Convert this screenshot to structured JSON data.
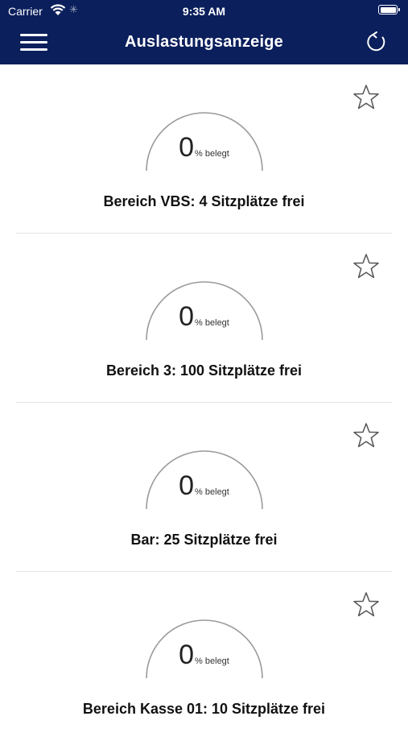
{
  "status_bar": {
    "carrier": "Carrier",
    "time": "9:35 AM"
  },
  "nav": {
    "title": "Auslastungsanzeige"
  },
  "areas": [
    {
      "occupancy_percent": "0",
      "unit": "% belegt",
      "title": "Bereich VBS: 4 Sitzplätze frei"
    },
    {
      "occupancy_percent": "0",
      "unit": "% belegt",
      "title": "Bereich 3: 100 Sitzplätze frei"
    },
    {
      "occupancy_percent": "0",
      "unit": "% belegt",
      "title": "Bar: 25 Sitzplätze frei"
    },
    {
      "occupancy_percent": "0",
      "unit": "% belegt",
      "title": "Bereich Kasse 01: 10 Sitzplätze frei"
    }
  ],
  "colors": {
    "header": "#0b1f5c",
    "gauge_track": "#9a9a9a",
    "divider": "#e3e3e3"
  }
}
